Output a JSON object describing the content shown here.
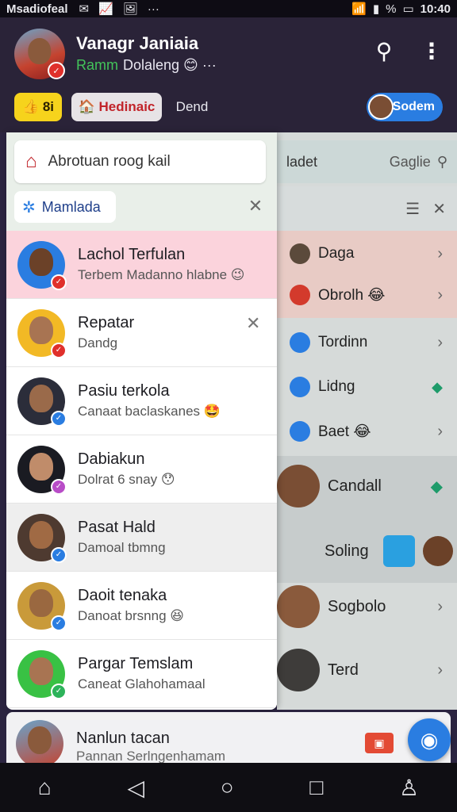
{
  "status_bar": {
    "carrier": "Msadiofeal",
    "icons": [
      "message-icon",
      "chart-icon",
      "image-icon",
      "more-dots-icon"
    ],
    "battery": "%",
    "time": "10:40"
  },
  "header": {
    "name": "Vanagr Janiaia",
    "status_green": "Ramm",
    "status_text": "Dolaleng 😊 ···",
    "chips": {
      "yellow": "👍 8i",
      "red": "🏠 Hedinaic",
      "plain": "Dend",
      "blue": "Sodem"
    }
  },
  "drawer": {
    "search_text": "Abrotuan roog kail",
    "filter_label": "Mamlada",
    "items": [
      {
        "title": "Lachol Terfulan",
        "subtitle": "Terbem Madanno hlabne 😉",
        "status_color": "#e0302b",
        "bg": "#fbd3dc",
        "skin": "#6b4128",
        "avatar_bg": "#2a7de1"
      },
      {
        "title": "Repatar",
        "subtitle": "Dandg",
        "status_color": "#e0302b",
        "bg": "#ffffff",
        "skin": "#a87452",
        "avatar_bg": "#f2b925"
      },
      {
        "title": "Pasiu terkola",
        "subtitle": "Canaat baclaskanes 🤩",
        "status_color": "#2a7de1",
        "bg": "#ffffff",
        "skin": "#9a6a4a",
        "avatar_bg": "#2b2d3a"
      },
      {
        "title": "Dabiakun",
        "subtitle": "Dolrat 6 snay 😯",
        "status_color": "#b84cc7",
        "bg": "#ffffff",
        "skin": "#c08c6a",
        "avatar_bg": "#1a1b22"
      },
      {
        "title": "Pasat Hald",
        "subtitle": "Damoal tbmng",
        "status_color": "#2a7de1",
        "bg": "#eeeeee",
        "skin": "#a06a44",
        "avatar_bg": "#4e3a30"
      },
      {
        "title": "Daoit tenaka",
        "subtitle": "Danoat brsnng 😆",
        "status_color": "#2a7de1",
        "bg": "#ffffff",
        "skin": "#9a6840",
        "avatar_bg": "#c99a3a"
      },
      {
        "title": "Pargar Temslam",
        "subtitle": "Caneat Glahohamaal",
        "status_color": "#2db35a",
        "bg": "#ffffff",
        "skin": "#a87452",
        "avatar_bg": "#39c144"
      }
    ]
  },
  "right_panel": {
    "search_label": "ladet",
    "search_right": "Gaglie",
    "rows": [
      {
        "label": "Daga",
        "trail": "chevron"
      },
      {
        "label": "Obrolh 😂",
        "trail": "chevron"
      },
      {
        "label": "Tordinn",
        "trail": "chevron"
      },
      {
        "label": "Lidng",
        "trail": "diamond"
      },
      {
        "label": "Baet 😂",
        "trail": "chevron"
      }
    ],
    "big_rows": [
      {
        "label": "Candall",
        "trail": "diamond"
      },
      {
        "label": "Soling",
        "trail": "none"
      },
      {
        "label": "Sogbolo",
        "trail": "chevron"
      },
      {
        "label": "Terd",
        "trail": "chevron"
      }
    ]
  },
  "peek": {
    "title": "Nanlun tacan",
    "subtitle": "Pannan Serlngenhamam"
  },
  "navbar": [
    "home-icon",
    "back-icon",
    "home-circle-icon",
    "recents-icon",
    "profile-icon"
  ]
}
